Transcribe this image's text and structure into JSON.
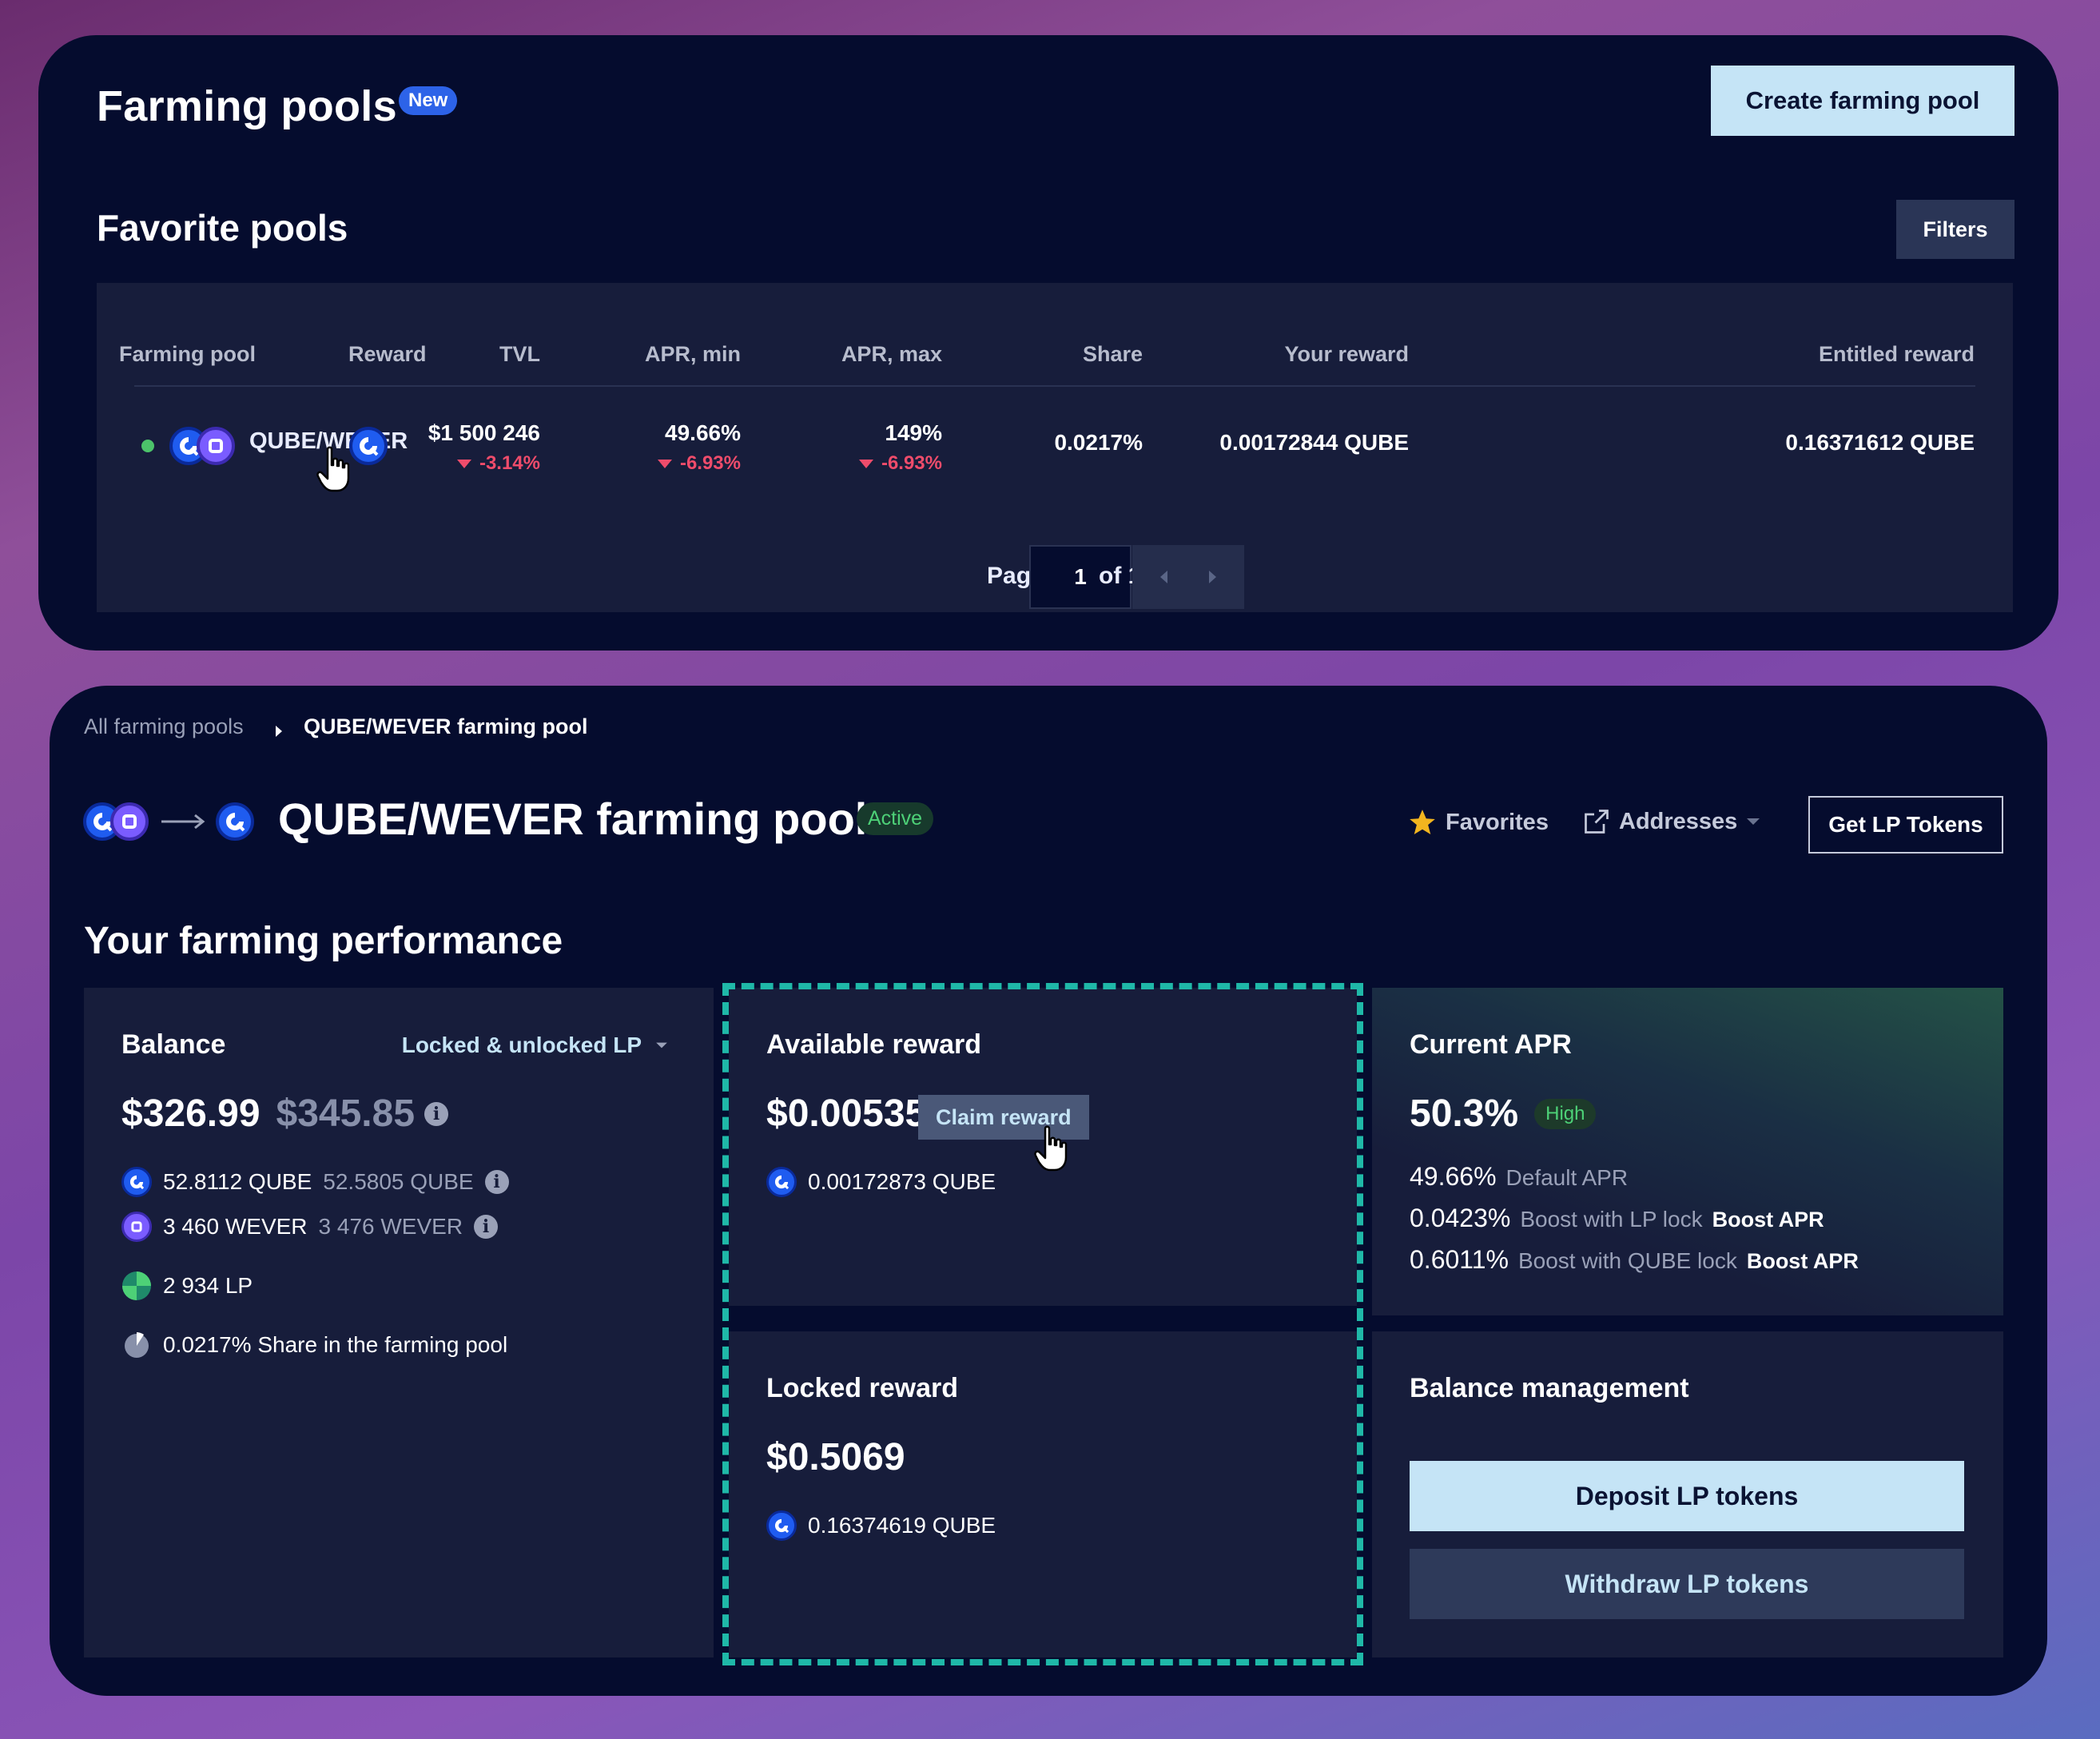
{
  "farming_pools": {
    "title": "Farming pools",
    "new_badge": "New",
    "create_button": "Create farming pool",
    "favorites_title": "Favorite pools",
    "filters_button": "Filters",
    "columns": {
      "farming_pool": "Farming pool",
      "reward": "Reward",
      "tvl": "TVL",
      "apr_min": "APR, min",
      "apr_max": "APR, max",
      "share": "Share",
      "your_reward": "Your reward",
      "entitled_reward": "Entitled reward"
    },
    "rows": [
      {
        "pool": "QUBE/WEVER",
        "tvl": "$1 500 246",
        "tvl_change": "-3.14%",
        "apr_min": "49.66%",
        "apr_min_change": "-6.93%",
        "apr_max": "149%",
        "apr_max_change": "-6.93%",
        "share": "0.0217%",
        "your_reward": "0.00172844 QUBE",
        "entitled_reward": "0.16371612 QUBE"
      }
    ],
    "pagination": {
      "page_label": "Page",
      "current_page": "1",
      "of_label": "of 1"
    }
  },
  "pool_detail": {
    "breadcrumb": {
      "all": "All farming pools",
      "current": "QUBE/WEVER farming pool"
    },
    "title": "QUBE/WEVER farming pool",
    "status": "Active",
    "favorites": "Favorites",
    "addresses": "Addresses",
    "get_lp_button": "Get LP Tokens",
    "performance_title": "Your farming performance",
    "balance": {
      "title": "Balance",
      "selector": "Locked & unlocked LP",
      "usd": "$326.99",
      "usd_total": "$345.85",
      "qube": "52.8112 QUBE",
      "qube_total": "52.5805 QUBE",
      "wever": "3 460 WEVER",
      "wever_total": "3 476 WEVER",
      "lp": "2 934 LP",
      "share": "0.0217% Share in the farming pool"
    },
    "available_reward": {
      "title": "Available reward",
      "usd": "$0.00535",
      "claim_button": "Claim reward",
      "amount": "0.00172873 QUBE"
    },
    "locked_reward": {
      "title": "Locked reward",
      "usd": "$0.5069",
      "amount": "0.16374619 QUBE"
    },
    "current_apr": {
      "title": "Current APR",
      "value": "50.3%",
      "level": "High",
      "default_value": "49.66%",
      "default_label": "Default APR",
      "lp_boost_value": "0.0423%",
      "lp_boost_label": "Boost with LP lock",
      "qube_boost_value": "0.6011%",
      "qube_boost_label": "Boost with QUBE lock",
      "boost_link": "Boost APR"
    },
    "balance_management": {
      "title": "Balance management",
      "deposit_button": "Deposit LP tokens",
      "withdraw_button": "Withdraw LP tokens"
    }
  },
  "colors": {
    "panel": "#050c2e",
    "card": "#171d3b",
    "accent_light": "#c5e4f6",
    "negative": "#ef4c6b",
    "positive": "#4dd177",
    "dashed_highlight": "#1fb8a8",
    "qube_coin": "#1f5cf0",
    "wever_coin": "#7a5cff"
  },
  "icons": [
    "qube-coin-icon",
    "wever-coin-icon",
    "lp-token-icon",
    "pie-share-icon",
    "star-icon",
    "external-link-icon",
    "chevron-down-icon",
    "chevron-left-icon",
    "chevron-right-icon",
    "info-icon",
    "hand-cursor-icon",
    "arrow-right-icon"
  ]
}
